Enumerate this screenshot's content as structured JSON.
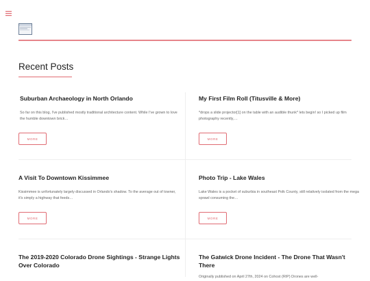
{
  "header": {
    "menu_icon": "hamburger-menu-icon",
    "logo_icon": "site-logo-icon",
    "accent_color": "#e06a72"
  },
  "section": {
    "title": "Recent Posts"
  },
  "posts": [
    {
      "title": "Suburban Archaeology in North Orlando",
      "excerpt": "So far on this blog, I've published mostly traditional architecture content. While I've grown to love the humble downtown brick…",
      "more_label": "MORE"
    },
    {
      "title": "My First Film Roll (Titusville & More)",
      "excerpt": "*drops a slide projector[1] on the table with an audible thunk* lets begin! so I picked up film photography recently,…",
      "more_label": "MORE"
    },
    {
      "title": "A Visit To Downtown Kissimmee",
      "excerpt": "Kissimmee is unfortunately largely discussed in Orlando's shadow. To the average out of towner, it's simply a highway that feeds…",
      "more_label": "MORE"
    },
    {
      "title": "Photo Trip - Lake Wales",
      "excerpt": "Lake Wales is a pocket of suburbia in southeast Polk County, still relatively isolated from the mega sprawl consuming the…",
      "more_label": "MORE"
    },
    {
      "title": "The 2019-2020 Colorado Drone Sightings - Strange Lights Over Colorado",
      "excerpt": "",
      "more_label": ""
    },
    {
      "title": "The Gatwick Drone Incident - The Drone That Wasn't There",
      "excerpt": "Originally published on April 27th, 2024 on Cohost (RIP) Drones are well-",
      "more_label": ""
    }
  ]
}
